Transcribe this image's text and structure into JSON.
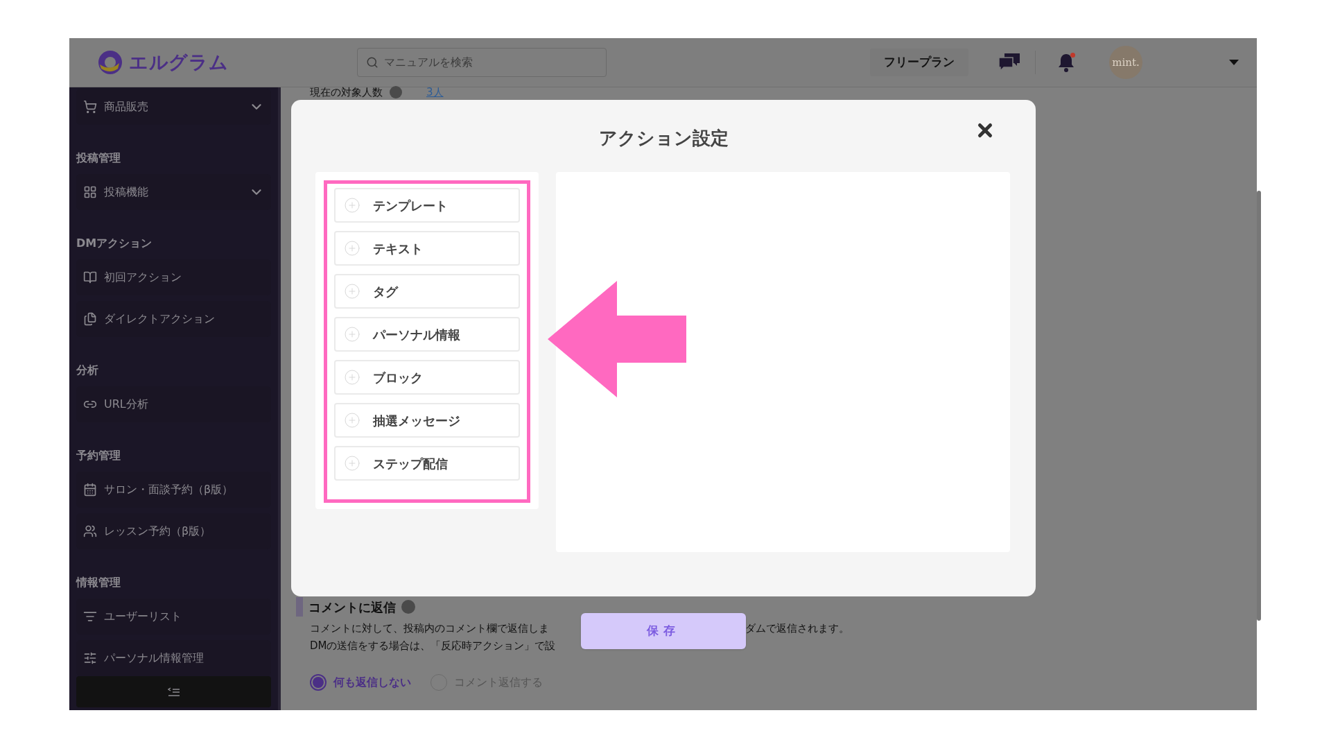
{
  "header": {
    "logo_text": "エルグラム",
    "search": {
      "placeholder": "マニュアルを検索"
    },
    "plan_button": "フリープラン",
    "notification_badge": true,
    "avatar_text": "mint."
  },
  "sidebar": {
    "sections": [
      {
        "items": [
          {
            "label": "商品販売",
            "expandable": true
          }
        ]
      },
      {
        "heading": "投稿管理",
        "items": [
          {
            "label": "投稿機能",
            "expandable": true
          }
        ]
      },
      {
        "heading": "DMアクション",
        "items": [
          {
            "label": "初回アクション",
            "expandable": false
          },
          {
            "label": "ダイレクトアクション",
            "expandable": false
          }
        ]
      },
      {
        "heading": "分析",
        "items": [
          {
            "label": "URL分析",
            "expandable": false
          }
        ]
      },
      {
        "heading": "予約管理",
        "items": [
          {
            "label": "サロン・面談予約（β版）",
            "expandable": false
          },
          {
            "label": "レッスン予約（β版）",
            "expandable": false
          }
        ]
      },
      {
        "heading": "情報管理",
        "items": [
          {
            "label": "ユーザーリスト",
            "expandable": false
          },
          {
            "label": "パーソナル情報管理",
            "expandable": false
          }
        ]
      }
    ]
  },
  "main": {
    "count_label": "現在の対象人数",
    "count_value": "3人",
    "section_title": "コメントに返信",
    "description": [
      {
        "before": "コメントに対して、投稿内のコメント欄で返信しま",
        "after": "ダムで返信されます。"
      },
      {
        "before": "DMの送信をする場合は、「反応時アクション」で設"
      }
    ],
    "radios": [
      {
        "label": "何も返信しない",
        "selected": true
      },
      {
        "label": "コメント返信する",
        "selected": false
      }
    ],
    "save_button": "保存"
  },
  "modal": {
    "title": "アクション設定",
    "items": [
      {
        "label": "テンプレート"
      },
      {
        "label": "テキスト"
      },
      {
        "label": "タグ"
      },
      {
        "label": "パーソナル情報"
      },
      {
        "label": "ブロック"
      },
      {
        "label": "抽選メッセージ"
      },
      {
        "label": "ステップ配信"
      }
    ]
  }
}
